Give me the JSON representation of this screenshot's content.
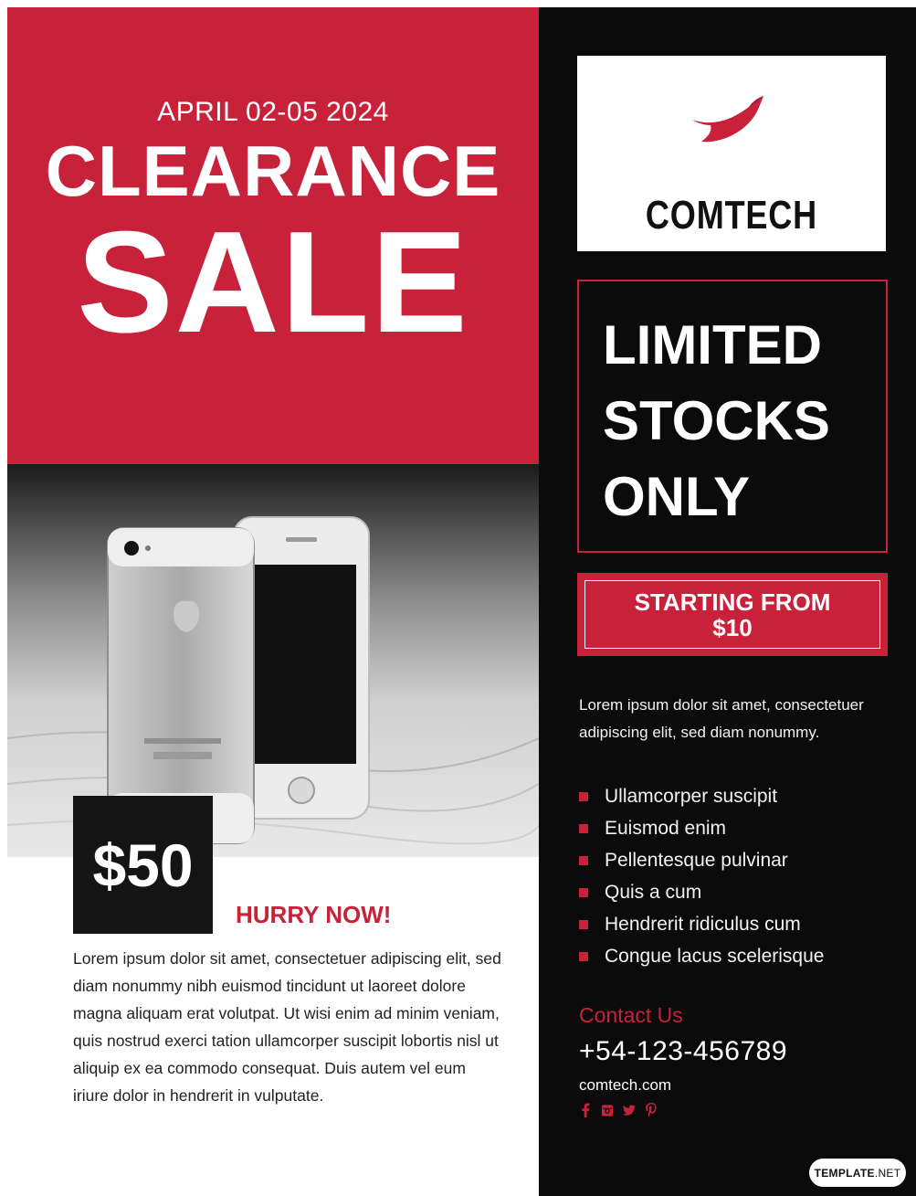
{
  "header": {
    "date": "APRIL 02-05 2024",
    "title_line_1": "CLEARANCE",
    "title_line_2": "SALE"
  },
  "product": {
    "price": "$50",
    "cta": "HURRY NOW!",
    "description": "Lorem ipsum dolor sit amet, consectetuer adipiscing elit, sed diam nonummy nibh euismod tincidunt ut laoreet dolore magna aliquam erat volutpat. Ut wisi enim ad minim veniam, quis nostrud exerci tation ullamcorper suscipit lobortis nisl ut aliquip ex ea commodo consequat. Duis autem vel eum iriure dolor in hendrerit in vulputate."
  },
  "brand": {
    "name": "COMTECH",
    "logo_icon": "bird-icon"
  },
  "promo": {
    "limited_lines": [
      "LIMITED",
      "STOCKS",
      "ONLY"
    ],
    "starting_line_1": "STARTING FROM",
    "starting_line_2": "$10"
  },
  "intro": "Lorem ipsum dolor sit amet, consectetuer adipiscing elit, sed diam nonummy.",
  "features": [
    "Ullamcorper suscipit",
    "Euismod enim",
    "Pellentesque pulvinar",
    "Quis a cum",
    "Hendrerit ridiculus cum",
    "Congue lacus scelerisque"
  ],
  "contact": {
    "title": "Contact Us",
    "phone": "+54-123-456789",
    "website": "comtech.com",
    "socials": [
      "facebook-icon",
      "instagram-icon",
      "twitter-icon",
      "pinterest-icon"
    ]
  },
  "watermark": {
    "brand": "TEMPLATE",
    "suffix": ".NET"
  },
  "colors": {
    "accent": "#c8213a",
    "dark": "#0b0b0b",
    "light": "#ffffff"
  }
}
